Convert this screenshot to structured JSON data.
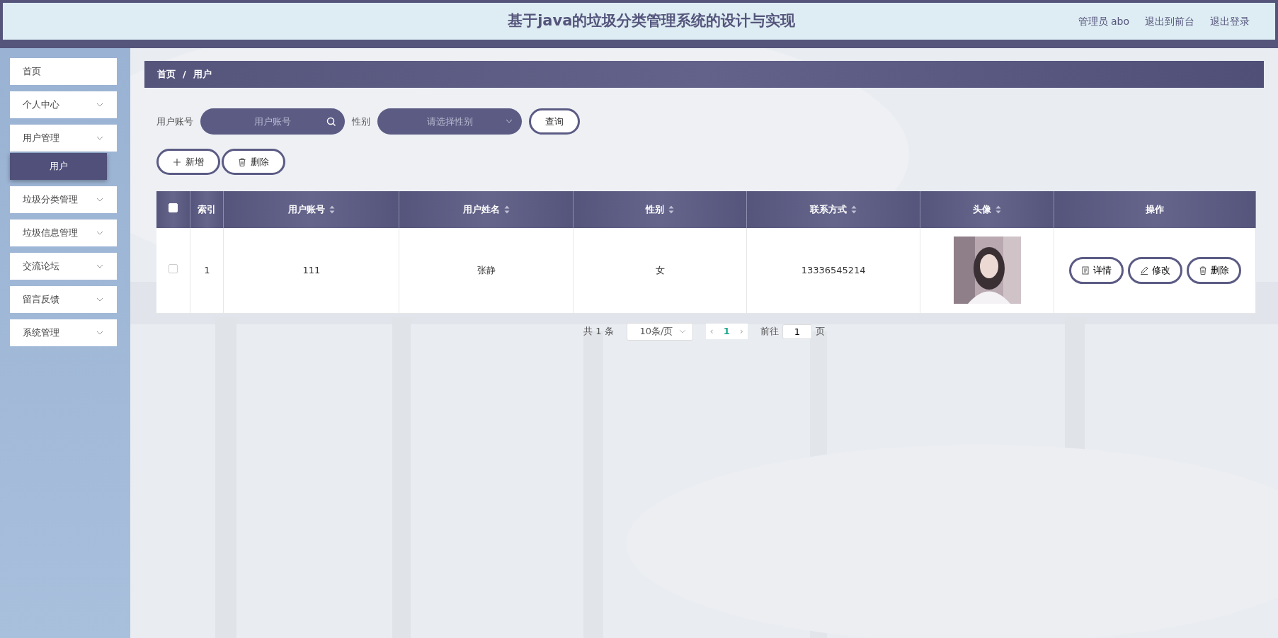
{
  "header": {
    "title": "基于java的垃圾分类管理系统的设计与实现",
    "links": [
      "管理员 abo",
      "退出到前台",
      "退出登录"
    ]
  },
  "sidebar": {
    "items": [
      {
        "label": "首页",
        "kind": "link"
      },
      {
        "label": "个人中心",
        "kind": "menu"
      },
      {
        "label": "用户管理",
        "kind": "menu",
        "children": [
          {
            "label": "用户",
            "selected": true
          }
        ]
      },
      {
        "label": "垃圾分类管理",
        "kind": "menu"
      },
      {
        "label": "垃圾信息管理",
        "kind": "menu"
      },
      {
        "label": "交流论坛",
        "kind": "menu"
      },
      {
        "label": "留言反馈",
        "kind": "menu"
      },
      {
        "label": "系统管理",
        "kind": "menu"
      }
    ]
  },
  "breadcrumb": {
    "items": [
      "首页",
      "用户"
    ],
    "separator": "/"
  },
  "search": {
    "fields": [
      {
        "label": "用户账号",
        "placeholder": "用户账号",
        "kind": "text"
      },
      {
        "label": "性别",
        "placeholder": "请选择性别",
        "kind": "select"
      }
    ],
    "button": "查询"
  },
  "actions": [
    {
      "label": "新增",
      "kind": "add"
    },
    {
      "label": "删除",
      "kind": "delete"
    }
  ],
  "table": {
    "select_all": {
      "checked": false
    },
    "columns": [
      {
        "label": "索引",
        "sortable": false
      },
      {
        "label": "用户账号",
        "sortable": true
      },
      {
        "label": "用户姓名",
        "sortable": true
      },
      {
        "label": "性别",
        "sortable": true
      },
      {
        "label": "联系方式",
        "sortable": true
      },
      {
        "label": "头像",
        "sortable": true
      },
      {
        "label": "操作",
        "sortable": false
      }
    ],
    "rows": [
      {
        "checked": false,
        "cells": [
          "1",
          "111",
          "张静",
          "女",
          "13336545214"
        ],
        "actions": [
          {
            "label": "详情",
            "kind": "detail"
          },
          {
            "label": "修改",
            "kind": "edit"
          },
          {
            "label": "删除",
            "kind": "delete"
          }
        ]
      }
    ]
  },
  "pagination": {
    "total": "共 1 条",
    "page_size": "10条/页",
    "prev": "‹",
    "next": "›",
    "pages": [
      {
        "label": "1",
        "selected": true
      }
    ],
    "goto_label": "前往",
    "goto_value": "1",
    "goto_suffix": "页"
  }
}
